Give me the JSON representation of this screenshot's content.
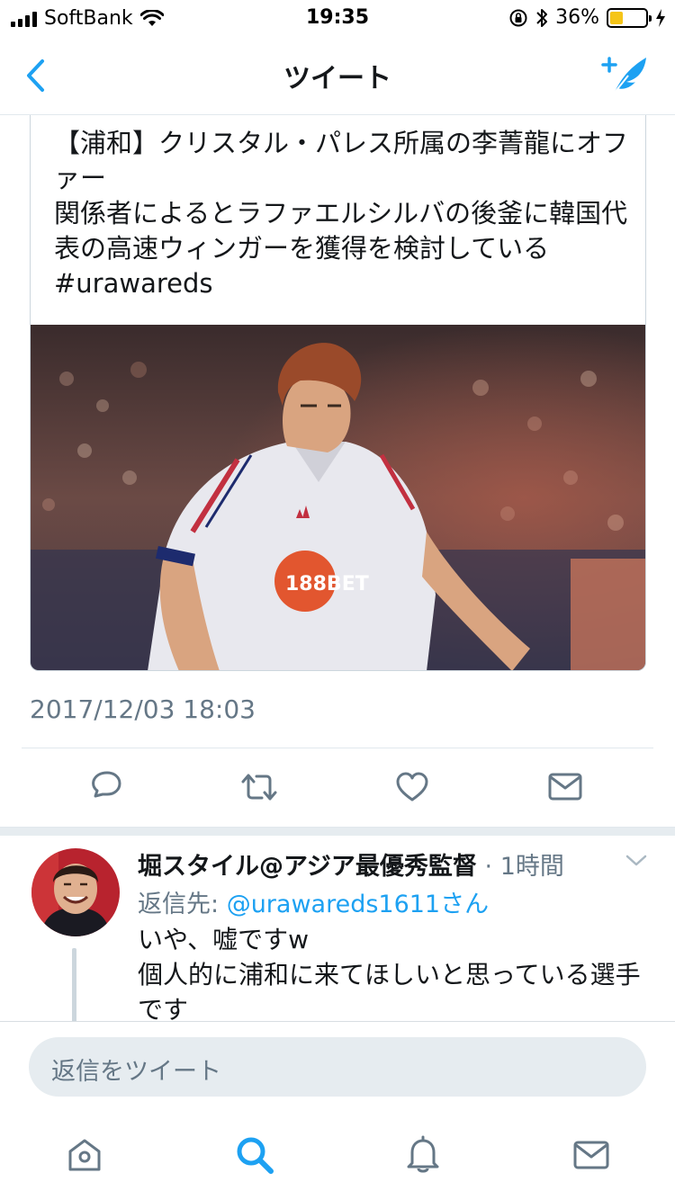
{
  "status_bar": {
    "carrier": "SoftBank",
    "time": "19:35",
    "battery_percent": "36%",
    "battery_level": 0.36
  },
  "nav": {
    "title": "ツイート",
    "back_icon": "chevron-left-icon",
    "compose_icon": "compose-tweet-icon"
  },
  "tweet": {
    "text": "【浦和】クリスタル・パレス所属の李菁龍にオファー\n関係者によるとラファエルシルバの後釜に韓国代表の高速ウィンガーを獲得を検討している\n#urawareds",
    "image_icon": "player-photo",
    "image_jersey_sponsor": "188BET",
    "timestamp": "2017/12/03 18:03"
  },
  "actions": [
    {
      "name": "reply",
      "icon": "reply-icon"
    },
    {
      "name": "retweet",
      "icon": "retweet-icon"
    },
    {
      "name": "like",
      "icon": "heart-icon"
    },
    {
      "name": "dm",
      "icon": "mail-icon"
    }
  ],
  "reply": {
    "name": "堀スタイル@アジア最優秀監督",
    "separator": "·",
    "time": "1時間",
    "reply_prefix": "返信先: ",
    "reply_handle": "@urawareds1611さん",
    "body": "いや、嘘ですw\n個人的に浦和に来てほしいと思っている選手です"
  },
  "composer": {
    "placeholder": "返信をツイート"
  },
  "tabs": [
    {
      "name": "home",
      "icon": "home-icon",
      "active": false
    },
    {
      "name": "search",
      "icon": "search-icon",
      "active": true
    },
    {
      "name": "notifications",
      "icon": "bell-icon",
      "active": false
    },
    {
      "name": "messages",
      "icon": "mail-icon",
      "active": false
    }
  ],
  "colors": {
    "accent": "#1da1f2",
    "secondary_text": "#657786",
    "icon_gray": "#657786",
    "battery_fill": "#f5c518"
  }
}
